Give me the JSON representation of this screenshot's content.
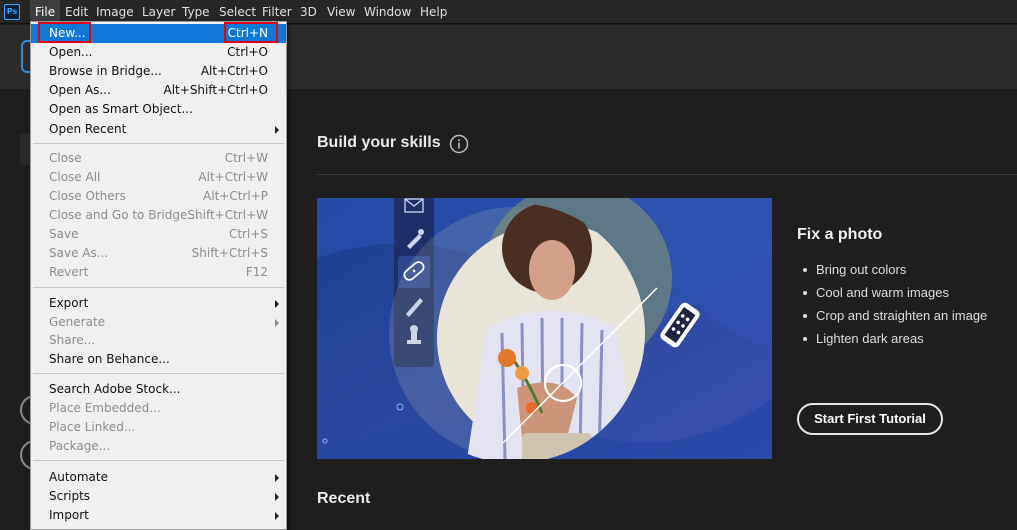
{
  "app": {
    "logo": "Ps"
  },
  "menubar": [
    "File",
    "Edit",
    "Image",
    "Layer",
    "Type",
    "Select",
    "Filter",
    "3D",
    "View",
    "Window",
    "Help"
  ],
  "file_menu": [
    {
      "label": "New...",
      "shortcut": "Ctrl+N",
      "state": "highlighted"
    },
    {
      "label": "Open...",
      "shortcut": "Ctrl+O"
    },
    {
      "label": "Browse in Bridge...",
      "shortcut": "Alt+Ctrl+O"
    },
    {
      "label": "Open As...",
      "shortcut": "Alt+Shift+Ctrl+O"
    },
    {
      "label": "Open as Smart Object..."
    },
    {
      "label": "Open Recent",
      "submenu": true
    },
    {
      "label": "Close",
      "shortcut": "Ctrl+W",
      "disabled": true
    },
    {
      "label": "Close All",
      "shortcut": "Alt+Ctrl+W",
      "disabled": true
    },
    {
      "label": "Close Others",
      "shortcut": "Alt+Ctrl+P",
      "disabled": true
    },
    {
      "label": "Close and Go to Bridge...",
      "shortcut": "Shift+Ctrl+W",
      "disabled": true
    },
    {
      "label": "Save",
      "shortcut": "Ctrl+S",
      "disabled": true
    },
    {
      "label": "Save As...",
      "shortcut": "Shift+Ctrl+S",
      "disabled": true
    },
    {
      "label": "Revert",
      "shortcut": "F12",
      "disabled": true
    },
    {
      "label": "Export",
      "submenu": true
    },
    {
      "label": "Generate",
      "submenu": true,
      "disabled": true
    },
    {
      "label": "Share...",
      "disabled": true
    },
    {
      "label": "Share on Behance..."
    },
    {
      "label": "Search Adobe Stock..."
    },
    {
      "label": "Place Embedded...",
      "disabled": true
    },
    {
      "label": "Place Linked...",
      "disabled": true
    },
    {
      "label": "Package...",
      "disabled": true
    },
    {
      "label": "Automate",
      "submenu": true
    },
    {
      "label": "Scripts",
      "submenu": true
    },
    {
      "label": "Import",
      "submenu": true
    }
  ],
  "home": {
    "build_skills_title": "Build your skills",
    "card": {
      "title": "Fix a photo",
      "bullets": [
        "Bring out colors",
        "Cool and warm images",
        "Crop and straighten an image",
        "Lighten dark areas"
      ],
      "button": "Start First Tutorial"
    },
    "recent_title": "Recent"
  },
  "colors": {
    "accent": "#0f78d7",
    "annotation_red": "#e1001a",
    "brand_blue": "#31a8ff"
  },
  "icons": [
    "info-icon",
    "envelope-icon",
    "eyedropper-icon",
    "bandage-icon",
    "brush-icon",
    "stamp-icon"
  ]
}
